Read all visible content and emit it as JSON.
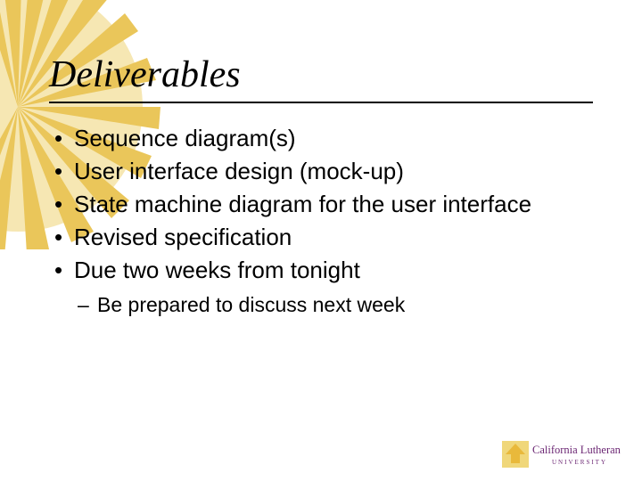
{
  "title": "Deliverables",
  "bullets": [
    {
      "text": "Sequence diagram(s)"
    },
    {
      "text": "User interface design (mock-up)"
    },
    {
      "text": "State machine diagram for the user interface"
    },
    {
      "text": "Revised specification"
    },
    {
      "text": "Due two weeks from tonight",
      "sub": [
        {
          "text": "Be prepared to discuss next week"
        }
      ]
    }
  ],
  "logo": {
    "line1": "California Lutheran",
    "line2": "UNIVERSITY"
  }
}
